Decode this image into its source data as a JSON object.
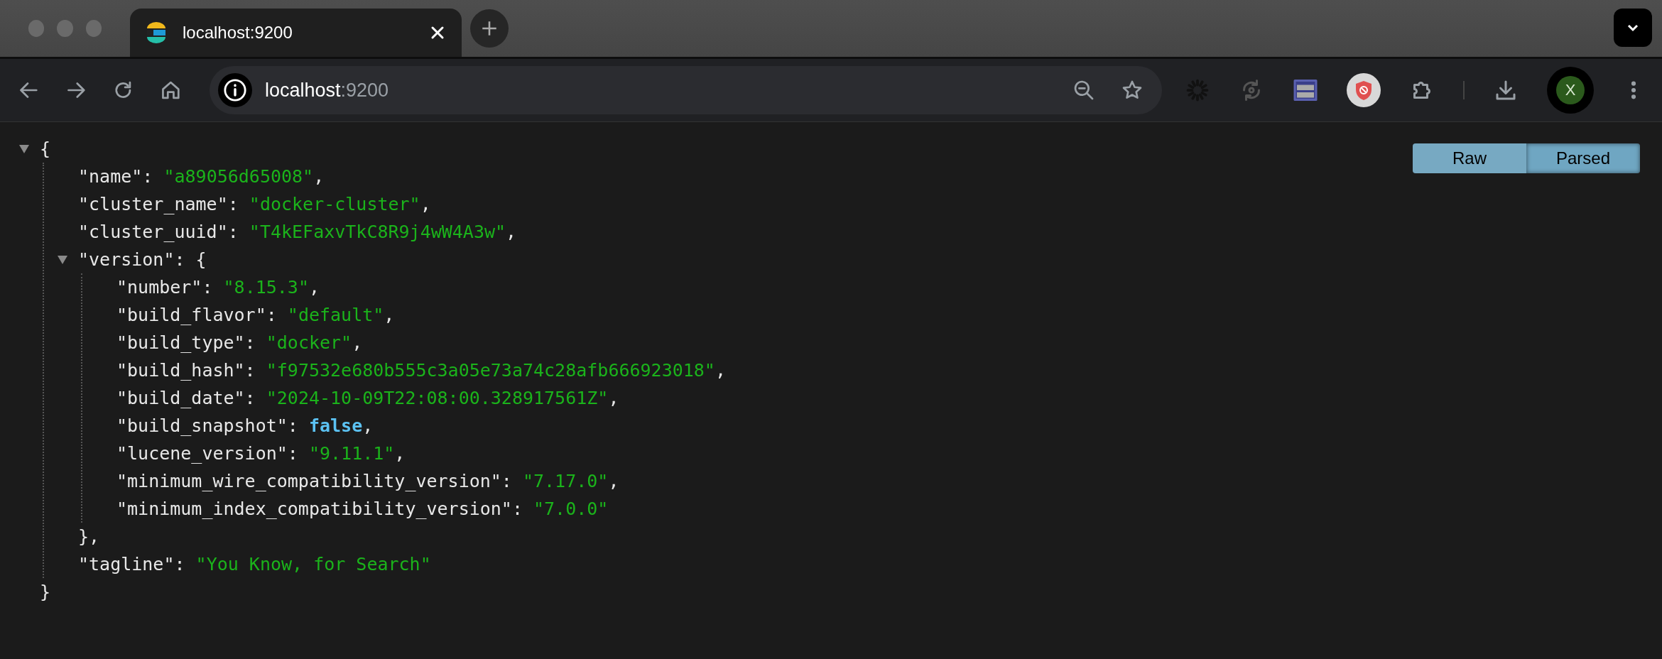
{
  "tab": {
    "title": "localhost:9200",
    "selected": true
  },
  "address_bar": {
    "host": "localhost",
    "port": ":9200"
  },
  "profile": {
    "initial": "X"
  },
  "view_toggle": [
    {
      "label": "Raw",
      "selected": false
    },
    {
      "label": "Parsed",
      "selected": true
    }
  ],
  "document": {
    "open": "{",
    "close": "}",
    "expanded": true,
    "children": [
      {
        "kind": "string",
        "key": "\"name\":",
        "value": "\"a89056d65008\"",
        "comma": ","
      },
      {
        "kind": "string",
        "key": "\"cluster_name\":",
        "value": "\"docker-cluster\"",
        "comma": ","
      },
      {
        "kind": "string",
        "key": "\"cluster_uuid\":",
        "value": "\"T4kEFaxvTkC8R9j4wW4A3w\"",
        "comma": ","
      },
      {
        "kind": "object",
        "key": "\"version\":",
        "open": "{",
        "close": "},",
        "expanded": true,
        "children": [
          {
            "kind": "string",
            "key": "\"number\":",
            "value": "\"8.15.3\"",
            "comma": ","
          },
          {
            "kind": "string",
            "key": "\"build_flavor\":",
            "value": "\"default\"",
            "comma": ","
          },
          {
            "kind": "string",
            "key": "\"build_type\":",
            "value": "\"docker\"",
            "comma": ","
          },
          {
            "kind": "string",
            "key": "\"build_hash\":",
            "value": "\"f97532e680b555c3a05e73a74c28afb666923018\"",
            "comma": ","
          },
          {
            "kind": "string",
            "key": "\"build_date\":",
            "value": "\"2024-10-09T22:08:00.328917561Z\"",
            "comma": ","
          },
          {
            "kind": "boolean",
            "key": "\"build_snapshot\":",
            "value": "false",
            "comma": ","
          },
          {
            "kind": "string",
            "key": "\"lucene_version\":",
            "value": "\"9.11.1\"",
            "comma": ","
          },
          {
            "kind": "string",
            "key": "\"minimum_wire_compatibility_version\":",
            "value": "\"7.17.0\"",
            "comma": ","
          },
          {
            "kind": "string",
            "key": "\"minimum_index_compatibility_version\":",
            "value": "\"7.0.0\""
          }
        ]
      },
      {
        "kind": "string",
        "key": "\"tagline\":",
        "value": "\"You Know, for Search\""
      }
    ]
  }
}
